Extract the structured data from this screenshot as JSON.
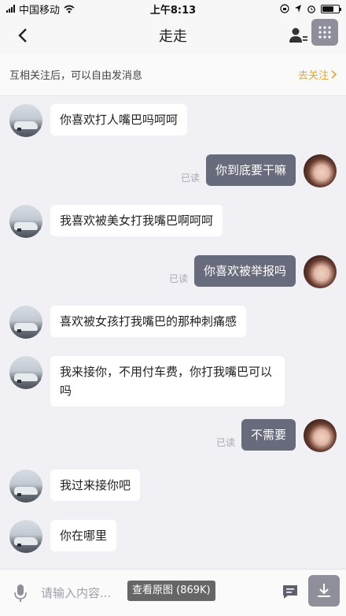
{
  "status_bar": {
    "carrier": "中国移动",
    "time": "上午8:13",
    "battery_level": 0.7
  },
  "nav": {
    "title": "走走"
  },
  "notice": {
    "text": "互相关注后，可以自由发消息",
    "follow_label": "去关注"
  },
  "messages": [
    {
      "side": "left",
      "text": "你喜欢打人嘴巴吗呵呵",
      "read": ""
    },
    {
      "side": "right",
      "text": "你到底要干嘛",
      "read": "已读"
    },
    {
      "side": "left",
      "text": "我喜欢被美女打我嘴巴啊呵呵",
      "read": ""
    },
    {
      "side": "right",
      "text": "你喜欢被举报吗",
      "read": "已读"
    },
    {
      "side": "left",
      "text": "喜欢被女孩打我嘴巴的那种刺痛感",
      "read": ""
    },
    {
      "side": "left",
      "text": "我来接你，不用付车费，你打我嘴巴可以吗",
      "read": ""
    },
    {
      "side": "right",
      "text": "不需要",
      "read": "已读"
    },
    {
      "side": "left",
      "text": "我过来接你吧",
      "read": ""
    },
    {
      "side": "left",
      "text": "你在哪里",
      "read": ""
    }
  ],
  "input": {
    "placeholder": "请输入内容...",
    "view_original": "查看原图 (869K)"
  },
  "colors": {
    "accent": "#e2a52a",
    "outgoing_bubble": "#686b7c",
    "incoming_bubble": "#ffffff",
    "background": "#f0f0f5"
  }
}
